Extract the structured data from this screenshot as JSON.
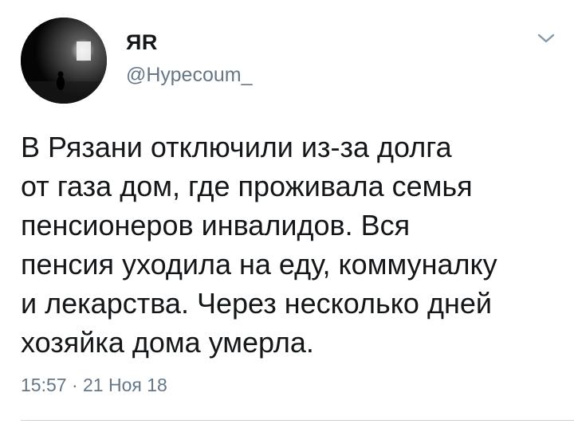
{
  "tweet": {
    "display_name": "ЯR",
    "handle": "@Нурecoum_",
    "text": "В Рязани отключили из-за долга\nот газа дом, где проживала семья\nпенсионеров инвалидов. Вся\nпенсия уходила на еду, коммуналку\nи лекарства. Через несколько дней\nхозяйка дома умерла.",
    "time": "15:57",
    "separator": "·",
    "date": "21 Ноя 18",
    "menu_icon": "chevron-down-icon",
    "avatar_icon": "dark-room-avatar"
  },
  "colors": {
    "text": "#14171a",
    "secondary": "#657786",
    "chevron": "#8899a6",
    "divider": "#c9d3da"
  }
}
